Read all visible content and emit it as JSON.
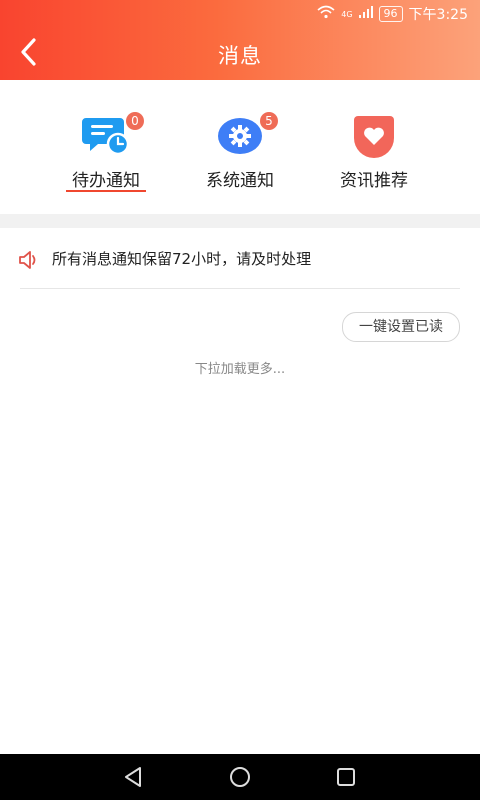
{
  "status_bar": {
    "network": "4G",
    "battery": "96",
    "time": "下午3:25"
  },
  "header": {
    "title": "消息",
    "back_icon": "chevron-left-icon"
  },
  "tabs": [
    {
      "label": "待办通知",
      "badge": "0",
      "icon": "chat-clock-icon",
      "color": "#1f9bf0",
      "active": true
    },
    {
      "label": "系统通知",
      "badge": "5",
      "icon": "gear-icon",
      "color": "#3e7ef6",
      "active": false
    },
    {
      "label": "资讯推荐",
      "badge": "",
      "icon": "heart-icon",
      "color": "#f2665a",
      "active": false
    }
  ],
  "notice": {
    "text": "所有消息通知保留72小时，请及时处理",
    "icon": "speaker-icon"
  },
  "actions": {
    "mark_all_read": "一键设置已读"
  },
  "list": {
    "load_more": "下拉加载更多..."
  },
  "colors": {
    "accent": "#f0472f",
    "gradient_start": "#f9442f",
    "gradient_end": "#fca27a",
    "badge": "#ef6c57"
  }
}
